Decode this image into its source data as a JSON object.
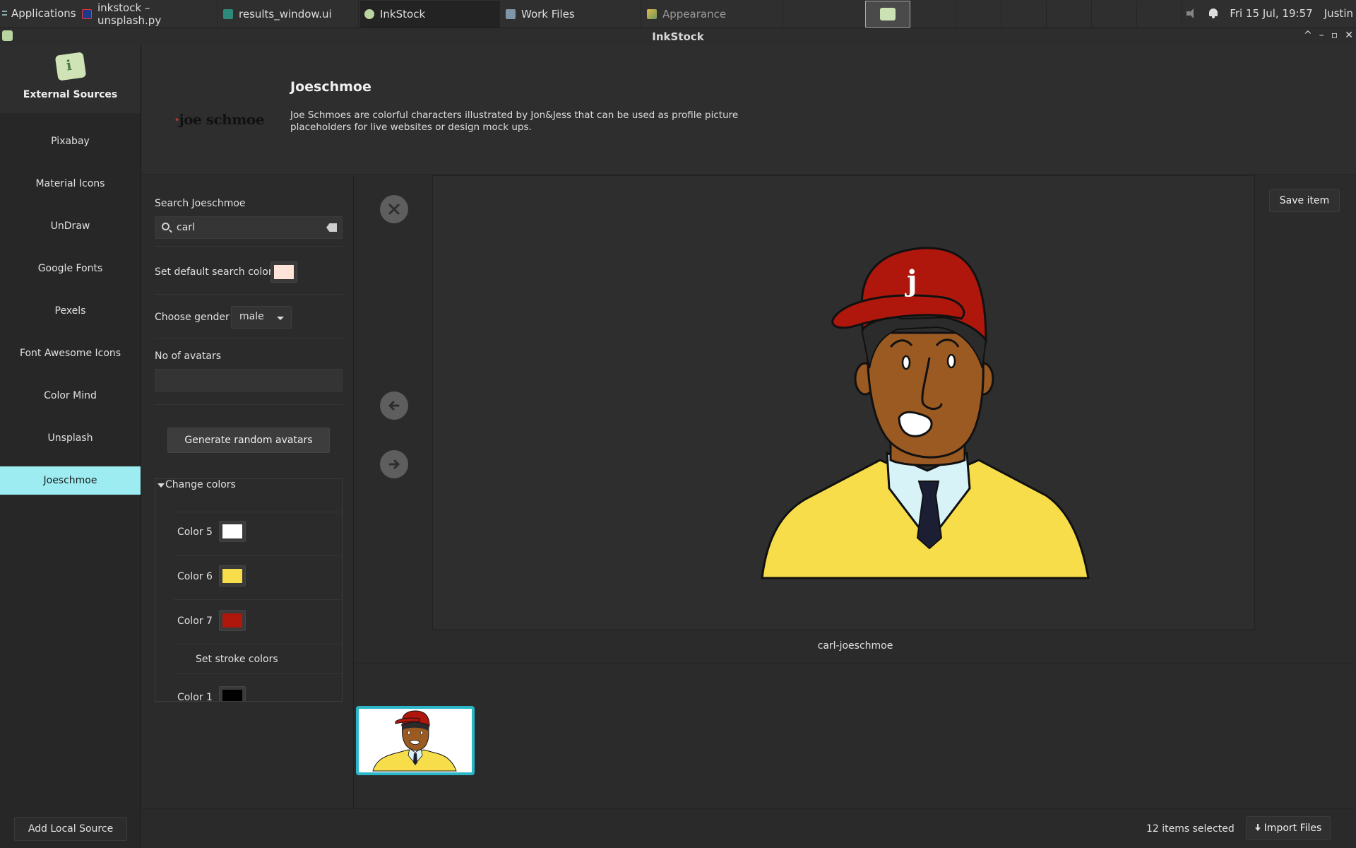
{
  "taskbar": {
    "applications_label": "Applications",
    "tabs": [
      {
        "label": "inkstock – unsplash.py",
        "icon": "pycharm-icon"
      },
      {
        "label": "results_window.ui",
        "icon": "glade-icon"
      },
      {
        "label": "InkStock",
        "icon": "inkstock-icon"
      },
      {
        "label": "Work Files",
        "icon": "folder-icon"
      },
      {
        "label": "Appearance",
        "icon": "appearance-icon"
      }
    ],
    "clock": "Fri 15 Jul, 19:57",
    "user": "Justin"
  },
  "window": {
    "title": "InkStock",
    "controls": [
      "^",
      "–",
      "▫",
      "✕"
    ]
  },
  "sidebar": {
    "brand": "External Sources",
    "items": [
      "Pixabay",
      "Material Icons",
      "UnDraw",
      "Google Fonts",
      "Pexels",
      "Font Awesome Icons",
      "Color Mind",
      "Unsplash",
      "Joeschmoe"
    ],
    "active_item": "Joeschmoe",
    "add_local_label": "Add Local Source"
  },
  "header": {
    "logo_text": "joe schmoe",
    "title": "Joeschmoe",
    "description": "Joe Schmoes are colorful characters illustrated by Jon&Jess that can be used as profile picture placeholders for live websites or design mock ups."
  },
  "form": {
    "search_label": "Search Joeschmoe",
    "search_value": "carl",
    "default_color_label": "Set default search color",
    "default_color": "#fde4d6",
    "gender_label": "Choose gender",
    "gender_value": "male",
    "avatars_label": "No of avatars",
    "avatars_value": "",
    "generate_label": "Generate random avatars",
    "change_colors_label": "Change colors",
    "colors": [
      {
        "label": "Color 5",
        "hex": "#ffffff"
      },
      {
        "label": "Color 6",
        "hex": "#f7dd4a"
      },
      {
        "label": "Color 7",
        "hex": "#b0170c"
      }
    ],
    "stroke_label": "Set stroke colors",
    "stroke_colors": [
      {
        "label": "Color 1",
        "hex": "#000000"
      }
    ]
  },
  "preview": {
    "item_name": "carl-joeschmoe",
    "save_label": "Save item"
  },
  "footer": {
    "selection_count": "12 items selected",
    "import_label": "Import Files"
  },
  "colors": {
    "accent": "#9cecf2",
    "thumb_border": "#2ab6c7",
    "skin": "#9b5a22",
    "cap": "#b0170c",
    "sweater": "#f7dd4a",
    "shirt": "#d8f3f8",
    "tie": "#1c1f33"
  }
}
